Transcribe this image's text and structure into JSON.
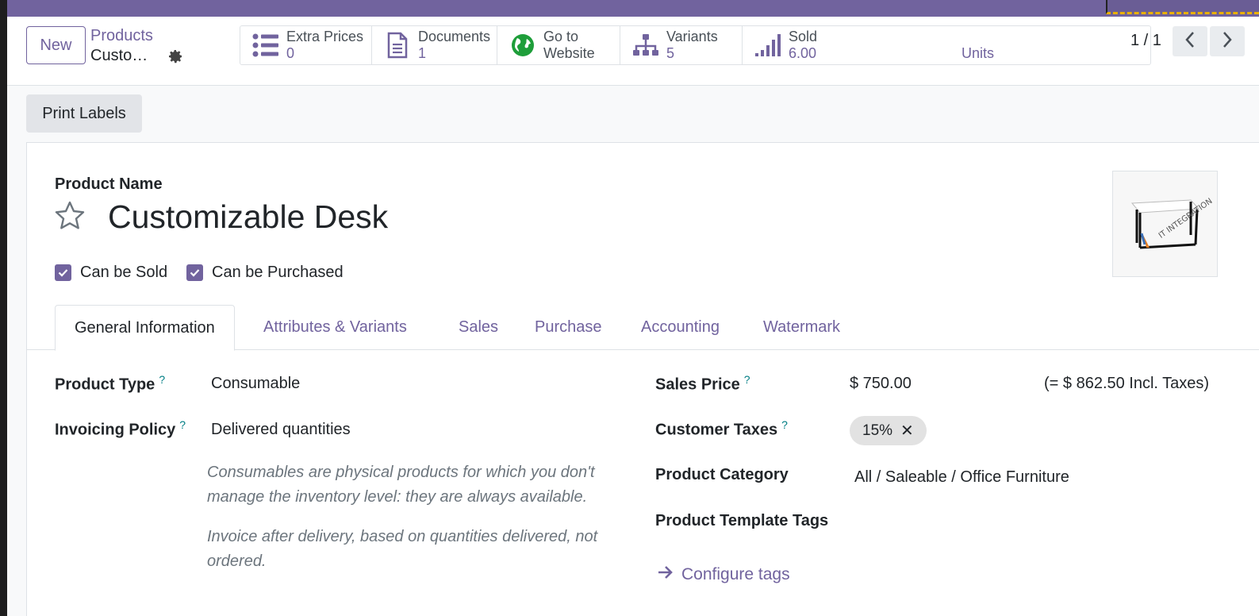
{
  "breadcrumb": {
    "parent": "Products",
    "current": "Custo…"
  },
  "control": {
    "new_label": "New",
    "pager": "1 / 1"
  },
  "smart_buttons": [
    {
      "label": "Extra Prices",
      "value": "0",
      "icon": "list-icon"
    },
    {
      "label": "Documents",
      "value": "1",
      "icon": "document-icon"
    },
    {
      "label": "Go to",
      "value": "Website",
      "icon": "globe-icon"
    },
    {
      "label": "Variants",
      "value": "5",
      "icon": "sitemap-icon"
    },
    {
      "label": "Sold",
      "value": "6.00",
      "icon": "signal-icon"
    }
  ],
  "sold_units": "Units",
  "actions": {
    "print_labels": "Print Labels"
  },
  "form": {
    "product_name_label": "Product Name",
    "product_name": "Customizable Desk",
    "can_be_sold": "Can be Sold",
    "can_be_purchased": "Can be Purchased",
    "image_caption": "IT INTEGRATION"
  },
  "tabs": [
    {
      "label": "General Information",
      "active": true
    },
    {
      "label": "Attributes & Variants",
      "active": false
    },
    {
      "label": "Sales",
      "active": false
    },
    {
      "label": "Purchase",
      "active": false
    },
    {
      "label": "Accounting",
      "active": false
    },
    {
      "label": "Watermark",
      "active": false
    }
  ],
  "general": {
    "product_type_label": "Product Type",
    "product_type": "Consumable",
    "invoicing_policy_label": "Invoicing Policy",
    "invoicing_policy": "Delivered quantities",
    "help_type": "Consumables are physical products for which you don't manage the inventory level: they are always available.",
    "help_invoice": "Invoice after delivery, based on quantities delivered, not ordered.",
    "sales_price_label": "Sales Price",
    "sales_price": "$ 750.00",
    "incl_taxes": "(= $ 862.50 Incl. Taxes)",
    "customer_taxes_label": "Customer Taxes",
    "tax_tag": "15%",
    "product_category_label": "Product Category",
    "product_category": "All / Saleable / Office Furniture",
    "template_tags_label": "Product Template Tags",
    "configure_tags": "Configure tags"
  },
  "colors": {
    "brand": "#71639e",
    "help_marker": "#017e84",
    "topbar": "#71639e"
  }
}
